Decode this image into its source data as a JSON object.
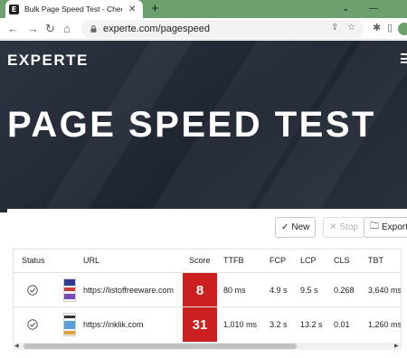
{
  "browser": {
    "tab_favicon": "E",
    "tab_title": "Bulk Page Speed Test - Check Yo",
    "tab_close": "✕",
    "new_tab": "+",
    "url": "experte.com/pagespeed",
    "window_controls": [
      "⌄",
      "—"
    ]
  },
  "site": {
    "logo": "EXPERTE",
    "hero_title": "PAGE SPEED TEST"
  },
  "actions": {
    "new_label": "New",
    "stop_label": "Stop",
    "export_label": "Export"
  },
  "table": {
    "headers": {
      "status": "Status",
      "url": "URL",
      "score": "Score",
      "ttfb": "TTFB",
      "fcp": "FCP",
      "lcp": "LCP",
      "cls": "CLS",
      "tbt": "TBT"
    },
    "rows": [
      {
        "url": "https://listoffreeware.com",
        "score": "8",
        "ttfb": "80 ms",
        "fcp": "4.9 s",
        "lcp": "9.5 s",
        "cls": "0.268",
        "tbt": "3,640 ms"
      },
      {
        "url": "https://inklik.com",
        "score": "31",
        "ttfb": "1,010 ms",
        "fcp": "3.2 s",
        "lcp": "13.2 s",
        "cls": "0.01",
        "tbt": "1,260 ms"
      }
    ]
  },
  "colors": {
    "score_bad": "#cc1f1f",
    "tabbar": "#6ca06e",
    "hero_bg": "#242a36"
  }
}
